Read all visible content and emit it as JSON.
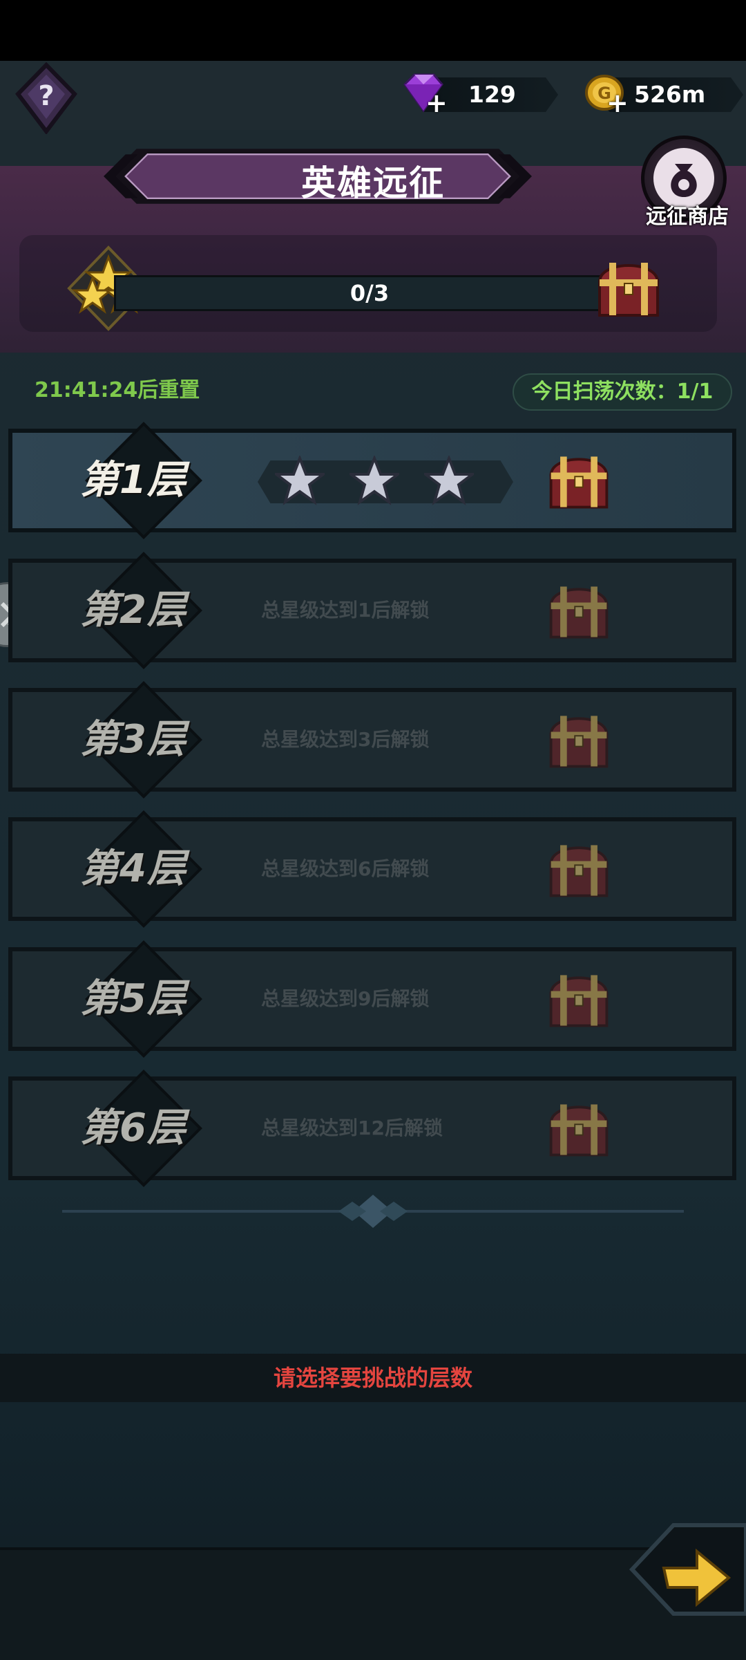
{
  "resources": {
    "gems": "129",
    "gold": "526m"
  },
  "banner": {
    "title": "英雄远征",
    "shop_label": "远征商店",
    "progress_text": "0/3",
    "progress_fraction": 0
  },
  "info": {
    "reset_text": "21:41:24后重置",
    "sweep_text": "今日扫荡次数：1/1"
  },
  "floors": [
    {
      "label": "第1层",
      "stars": 3,
      "unlocked": true
    },
    {
      "label": "第2层",
      "lock_text": "总星级达到1后解锁"
    },
    {
      "label": "第3层",
      "lock_text": "总星级达到3后解锁"
    },
    {
      "label": "第4层",
      "lock_text": "总星级达到6后解锁"
    },
    {
      "label": "第5层",
      "lock_text": "总星级达到9后解锁"
    },
    {
      "label": "第6层",
      "lock_text": "总星级达到12后解锁"
    }
  ],
  "hint": "请选择要挑战的层数",
  "colors": {
    "reset_green": "#7fc94c",
    "hint_red": "#e4453f",
    "banner_purple": "#4a2b48"
  },
  "icons": {
    "help": "question-mark-icon",
    "gem": "purple-gem-icon",
    "gold": "gold-coin-icon",
    "shop": "money-bag-icon",
    "chest": "treasure-chest-icon",
    "next": "arrow-right-icon"
  }
}
